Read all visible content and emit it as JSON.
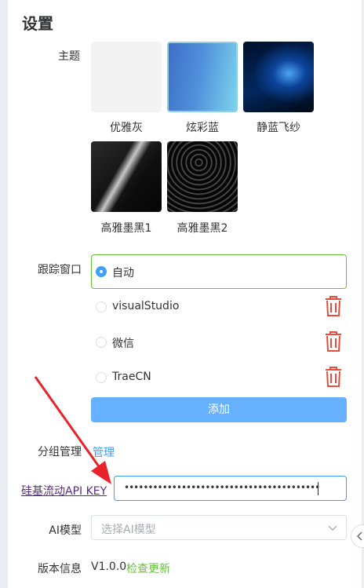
{
  "settings": {
    "title": "设置",
    "theme": {
      "label": "主题",
      "options": [
        {
          "name": "优雅灰",
          "selected": false
        },
        {
          "name": "炫彩蓝",
          "selected": true
        },
        {
          "name": "静蓝飞纱",
          "selected": false
        },
        {
          "name": "高雅墨黑1",
          "selected": false
        },
        {
          "name": "高雅墨黑2",
          "selected": false
        }
      ]
    },
    "tracking": {
      "label": "跟踪窗口",
      "options": [
        {
          "label": "自动",
          "checked": true
        },
        {
          "label": "visualStudio",
          "checked": false
        },
        {
          "label": "微信",
          "checked": false
        },
        {
          "label": "TraeCN",
          "checked": false
        }
      ],
      "add_label": "添加"
    },
    "group": {
      "label": "分组管理",
      "manage_link": "管理"
    },
    "api_key": {
      "link_label": "硅基流动API KEY",
      "masked_value": "••••••••••••••••••••••••••••••••••••••••••••••••••"
    },
    "ai_model": {
      "label": "AI模型",
      "placeholder": "选择AI模型"
    },
    "version": {
      "label": "版本信息",
      "value": "V1.0.0",
      "check_update": "检查更新"
    }
  },
  "colors": {
    "accent": "#409eff",
    "success": "#67c23a",
    "danger": "#e74c3c",
    "annotation_arrow": "#e8232a",
    "api_link": "#5b2c87"
  },
  "icons": {
    "delete": "trash-icon",
    "dropdown": "chevron-down-icon",
    "collapse": "chevron-left-icon"
  }
}
